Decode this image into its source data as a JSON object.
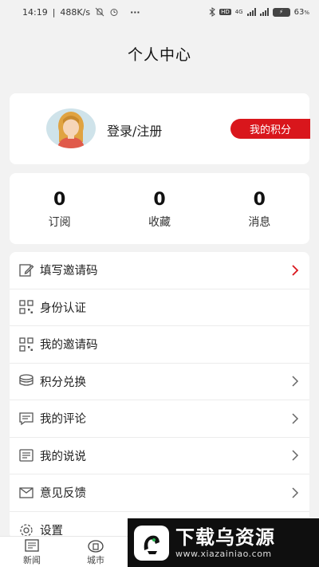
{
  "status_bar": {
    "time": "14:19",
    "speed": "488K/s",
    "more": "···",
    "hd_badge": "HD",
    "network": "4G",
    "battery_level": "63",
    "battery_unit": "%"
  },
  "header": {
    "title": "个人中心"
  },
  "profile": {
    "login_label": "登录/注册",
    "points_button": "我的积分"
  },
  "stats": [
    {
      "count": "0",
      "label": "订阅"
    },
    {
      "count": "0",
      "label": "收藏"
    },
    {
      "count": "0",
      "label": "消息"
    }
  ],
  "menu": [
    {
      "label": "填写邀请码",
      "icon": "pencil-icon",
      "chevron": "red"
    },
    {
      "label": "身份认证",
      "icon": "qr-code-icon",
      "chevron": "none"
    },
    {
      "label": "我的邀请码",
      "icon": "qr-code-icon",
      "chevron": "none"
    },
    {
      "label": "积分兑换",
      "icon": "coins-icon",
      "chevron": "gray"
    },
    {
      "label": "我的评论",
      "icon": "comment-icon",
      "chevron": "gray"
    },
    {
      "label": "我的说说",
      "icon": "document-icon",
      "chevron": "gray"
    },
    {
      "label": "意见反馈",
      "icon": "mail-icon",
      "chevron": "gray"
    },
    {
      "label": "设置",
      "icon": "gear-icon",
      "chevron": "none"
    }
  ],
  "tabs": [
    {
      "label": "新闻",
      "icon": "news-icon"
    },
    {
      "label": "城市",
      "icon": "city-icon"
    }
  ],
  "watermark": {
    "title": "下载乌资源",
    "url": "www.xiazainiao.com"
  },
  "colors": {
    "accent_red": "#d9161c",
    "page_background": "#f2f2f2",
    "card_background": "#ffffff"
  }
}
